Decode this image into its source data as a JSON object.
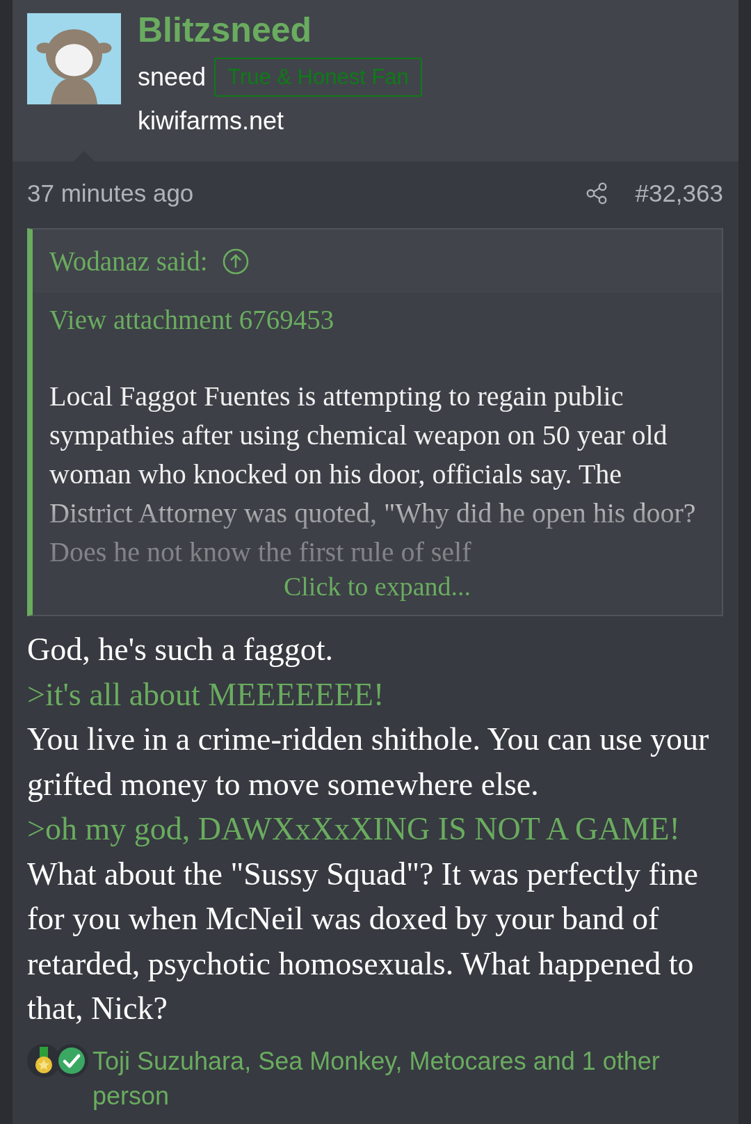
{
  "post": {
    "author": "Blitzsneed",
    "user_title": "sneed",
    "banner": "True & Honest Fan",
    "location": "kiwifarms.net",
    "time": "37 minutes ago",
    "number": "#32,363"
  },
  "quote": {
    "author_line": "Wodanaz said:",
    "attachment": "View attachment 6769453",
    "text": "Local Faggot Fuentes is attempting to regain public sympathies after using chemical weapon on 50 year old woman who knocked on his door, officials say. The District Attorney was quoted, \"Why did he open his door? Does he not know the first rule of self",
    "expand": "Click to expand..."
  },
  "body": [
    {
      "kind": "text",
      "text": "God, he's such a faggot."
    },
    {
      "kind": "greentext",
      "text": ">it's all about MEEEEEEE!"
    },
    {
      "kind": "text",
      "text": "You live in a crime-ridden shithole. You can use your grifted money to move somewhere else."
    },
    {
      "kind": "greentext",
      "text": ">oh my god, DAWXxXxXING IS NOT A GAME!"
    },
    {
      "kind": "text",
      "text": "What about the \"Sussy Squad\"? It was perfectly fine for you when McNeil was doxed by your band of retarded, psychotic homosexuals. What happened to that, Nick?"
    }
  ],
  "reactions": {
    "text": "Toji Suzuhara, Sea Monkey, Metocares and 1 other person"
  }
}
